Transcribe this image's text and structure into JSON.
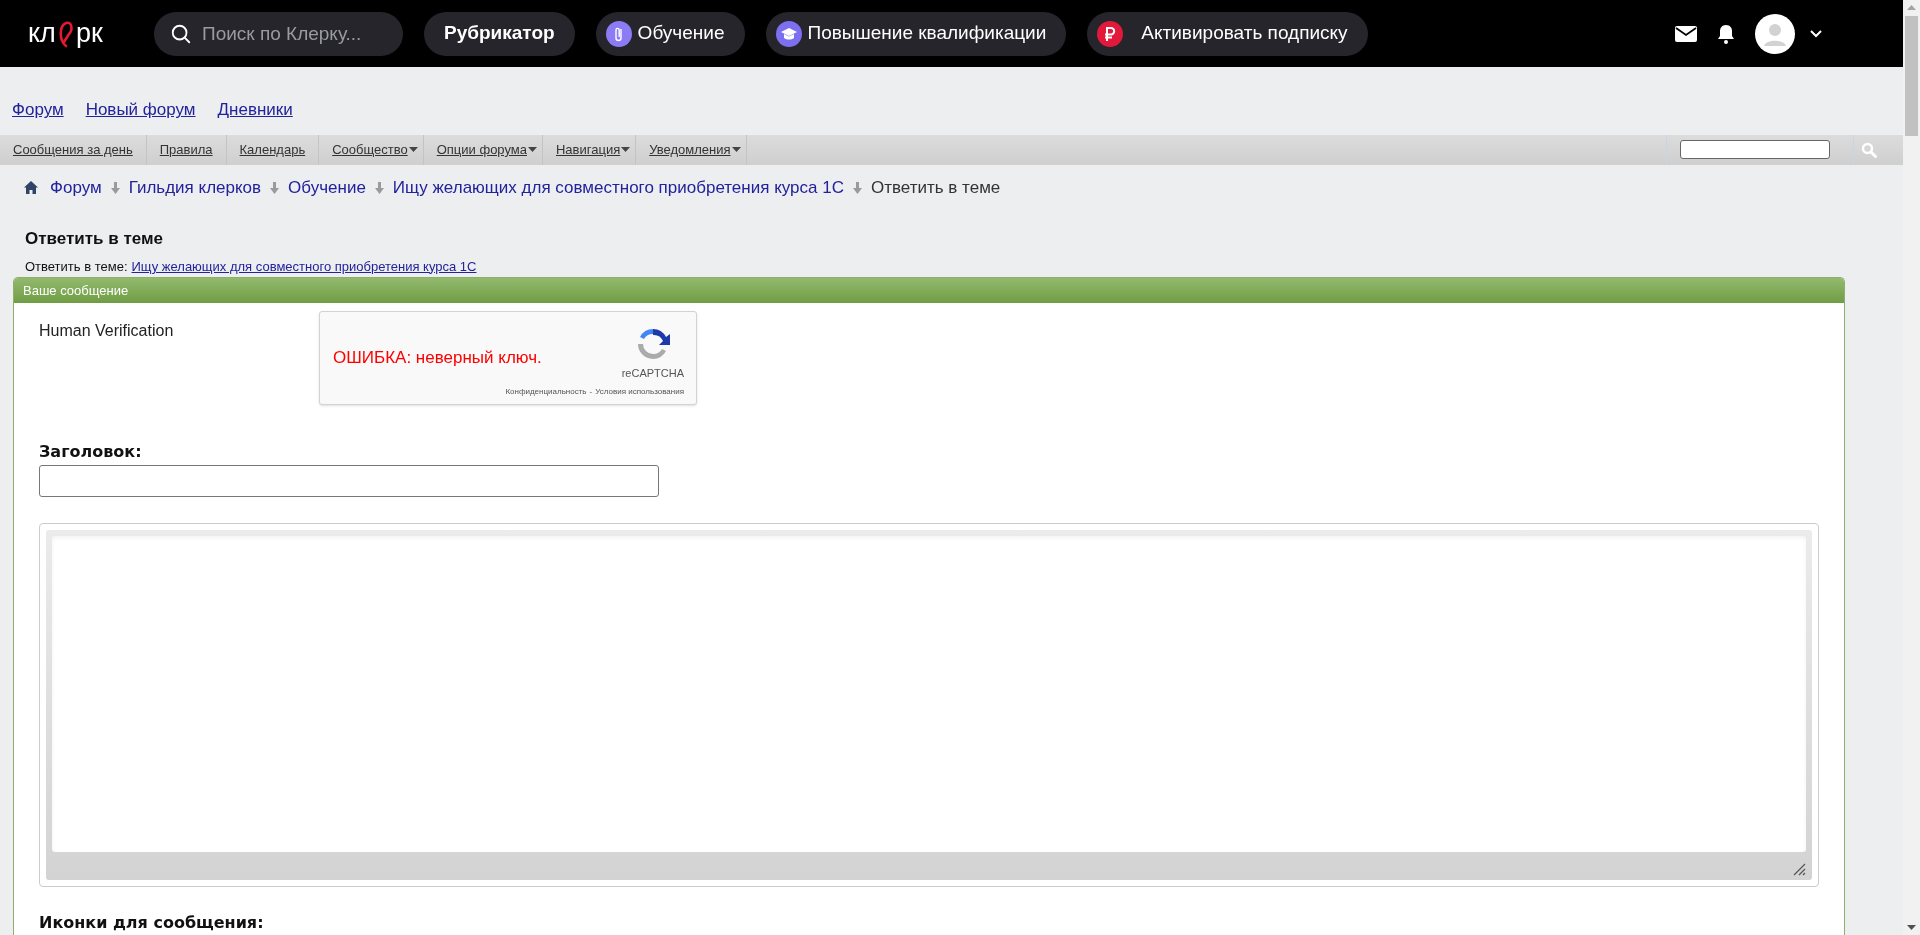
{
  "header": {
    "logo": "кл",
    "logo_end": "рк",
    "search": {
      "placeholder": "Поиск по Клерку..."
    },
    "buttons": [
      {
        "label": "Рубрикатор",
        "kind": "plain"
      },
      {
        "label": "Обучение",
        "kind": "clip"
      },
      {
        "label": "Повышение квалификации",
        "kind": "cap"
      },
      {
        "label": "Активировать подписку",
        "kind": "ruble"
      }
    ]
  },
  "forum_links": [
    "Форум",
    "Новый форум",
    "Дневники"
  ],
  "navbar": {
    "items": [
      {
        "label": "Сообщения за день",
        "dropdown": false
      },
      {
        "label": "Правила",
        "dropdown": false
      },
      {
        "label": "Календарь",
        "dropdown": false
      },
      {
        "label": "Сообщество",
        "dropdown": true
      },
      {
        "label": "Опции форума",
        "dropdown": true
      },
      {
        "label": "Навигация",
        "dropdown": true
      },
      {
        "label": "Уведомления",
        "dropdown": true
      }
    ]
  },
  "breadcrumb": {
    "links": [
      "Форум",
      "Гильдия клерков",
      "Обучение",
      "Ищу желающих для совместного приобретения курса 1С"
    ],
    "current": "Ответить в теме"
  },
  "page_title": "Ответить в теме",
  "subtitle": {
    "label": "Ответить в теме:",
    "link": "Ищу желающих для совместного приобретения курса 1С"
  },
  "panel": {
    "title": "Ваше сообщение",
    "verification": {
      "label": "Human Verification",
      "error": "ОШИБКА: неверный ключ.",
      "brand": "reCAPTCHA",
      "privacy": "Конфиденциальность",
      "separator": "-",
      "terms": "Условия использования"
    },
    "title_field": {
      "label": "Заголовок:"
    },
    "icons_label": "Иконки для сообщения:"
  }
}
